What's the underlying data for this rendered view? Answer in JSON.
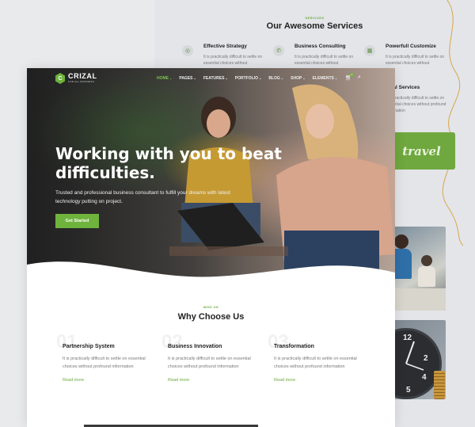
{
  "services": {
    "kicker": "SERVICES",
    "title": "Our Awesome Services",
    "items": [
      {
        "title": "Effective Strategy",
        "desc": "It is practically difficult to settle on essential choices without",
        "icon": "target-icon"
      },
      {
        "title": "Business Consulting",
        "desc": "It is practically difficult to settle on essential choices without",
        "icon": "chat-icon"
      },
      {
        "title": "Powerfull Customize",
        "desc": "It is practically difficult to settle on essential choices without",
        "icon": "grid-icon"
      },
      {
        "title": "ncial Services",
        "desc": "It is practically difficult to settle on essential choices without profound information",
        "icon": "none"
      }
    ],
    "travel_label": "travel"
  },
  "header": {
    "logo_name": "CRIZAL",
    "logo_tag": "FOR ALL BUSINESS",
    "logo_letter": "C",
    "nav": [
      "HOME",
      "PAGES",
      "FEATURES",
      "PORTFOLIO",
      "BLOG",
      "SHOP",
      "ELEMENTS"
    ],
    "cart_count": "0"
  },
  "hero": {
    "title": "Working with you to beat difficulties.",
    "subtitle": "Trusted and professional business consultant to fulfill your dreams with latest technology putting on project.",
    "cta": "Get Started"
  },
  "why": {
    "kicker": "WHO US",
    "title": "Why Choose Us",
    "features": [
      {
        "num": "01",
        "title": "Partnership System",
        "desc": "It is practically difficult to settle on essential choices without profound information",
        "more": "Read more"
      },
      {
        "num": "02",
        "title": "Business Innovation",
        "desc": "It is practically difficult to settle on essential choices without profound information",
        "more": "Read more"
      },
      {
        "num": "03",
        "title": "Transformation",
        "desc": "It is practically difficult to settle on essential choices without profound information",
        "more": "Read more"
      }
    ]
  },
  "colors": {
    "accent": "#6fb33d",
    "dark": "#222222"
  }
}
